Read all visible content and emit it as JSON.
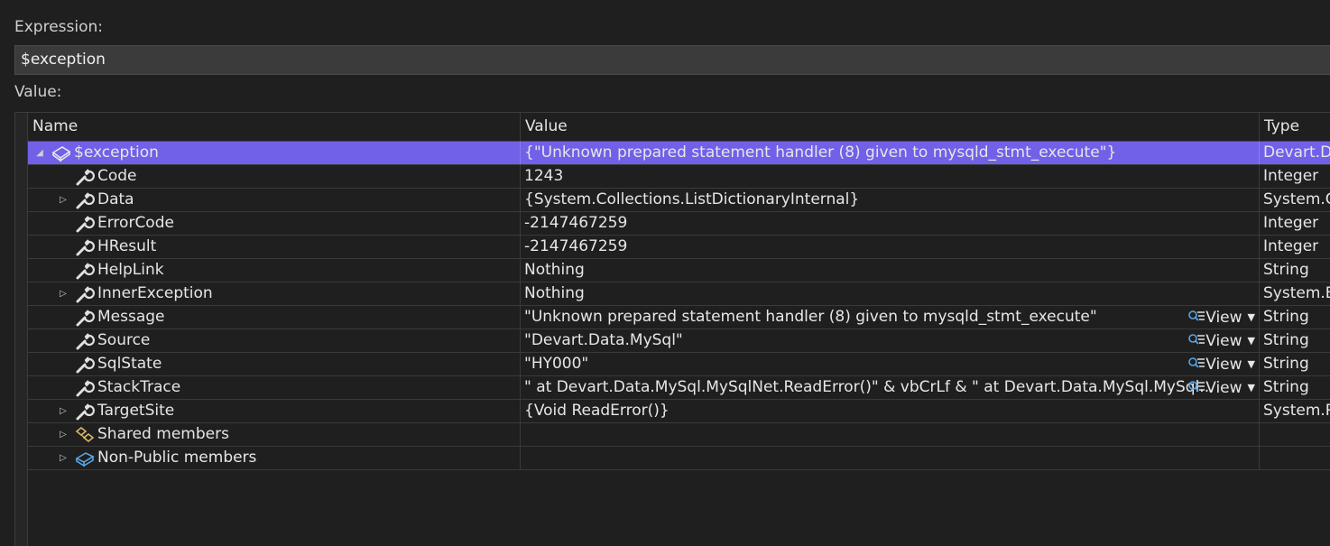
{
  "expression": {
    "label": "Expression:",
    "value": "$exception"
  },
  "value_label": "Value:",
  "columns": {
    "name": "Name",
    "value": "Value",
    "type": "Type"
  },
  "rows": [
    {
      "name": "$exception",
      "value": "{\"Unknown prepared statement handler (8) given to mysqld_stmt_execute\"}",
      "type": "Devart.Data",
      "icon": "exception-icon",
      "expander": "collapse",
      "indent": 0,
      "selected": true
    },
    {
      "name": "Code",
      "value": "1243",
      "type": "Integer",
      "icon": "wrench-icon",
      "expander": "",
      "indent": 1
    },
    {
      "name": "Data",
      "value": "{System.Collections.ListDictionaryInternal}",
      "type": "System.Co",
      "icon": "wrench-icon",
      "expander": "expand",
      "indent": 1
    },
    {
      "name": "ErrorCode",
      "value": "-2147467259",
      "type": "Integer",
      "icon": "wrench-icon",
      "expander": "",
      "indent": 1
    },
    {
      "name": "HResult",
      "value": "-2147467259",
      "type": "Integer",
      "icon": "wrench-icon",
      "expander": "",
      "indent": 1
    },
    {
      "name": "HelpLink",
      "value": "Nothing",
      "type": "String",
      "icon": "wrench-icon",
      "expander": "",
      "indent": 1
    },
    {
      "name": "InnerException",
      "value": "Nothing",
      "type": "System.Ex",
      "icon": "wrench-icon",
      "expander": "expand",
      "indent": 1
    },
    {
      "name": "Message",
      "value": "\"Unknown prepared statement handler (8) given to mysqld_stmt_execute\"",
      "type": "String",
      "icon": "wrench-icon",
      "expander": "",
      "indent": 1,
      "view": "View"
    },
    {
      "name": "Source",
      "value": "\"Devart.Data.MySql\"",
      "type": "String",
      "icon": "wrench-icon",
      "expander": "",
      "indent": 1,
      "view": "View"
    },
    {
      "name": "SqlState",
      "value": "\"HY000\"",
      "type": "String",
      "icon": "wrench-icon",
      "expander": "",
      "indent": 1,
      "view": "View"
    },
    {
      "name": "StackTrace",
      "value": "\"   at Devart.Data.MySql.MySqlNet.ReadError()\" & vbCrLf & \"   at Devart.Data.MySql.MySql...",
      "type": "String",
      "icon": "wrench-icon",
      "expander": "",
      "indent": 1,
      "view": "View"
    },
    {
      "name": "TargetSite",
      "value": "{Void ReadError()}",
      "type": "System.Re",
      "icon": "wrench-icon",
      "expander": "expand",
      "indent": 1
    },
    {
      "name": "Shared members",
      "value": "",
      "type": "",
      "icon": "shared-members-icon",
      "expander": "expand",
      "indent": 1
    },
    {
      "name": "Non-Public members",
      "value": "",
      "type": "",
      "icon": "non-public-members-icon",
      "expander": "expand",
      "indent": 1
    }
  ]
}
